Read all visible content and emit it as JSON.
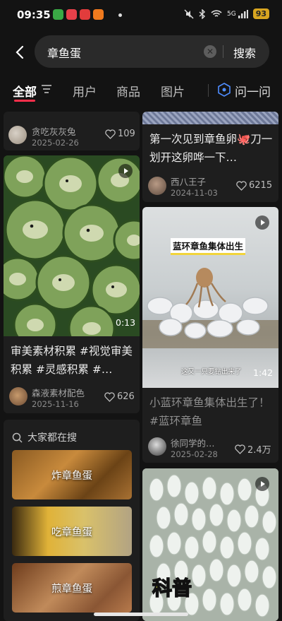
{
  "status": {
    "time": "09:35",
    "battery": "93",
    "network": "5G"
  },
  "search": {
    "query": "章鱼蛋",
    "button": "搜索"
  },
  "tabs": {
    "all": "全部",
    "users": "用户",
    "goods": "商品",
    "images": "图片",
    "ask": "问一问"
  },
  "posts": {
    "p1": {
      "author": "贪吃灰灰兔",
      "date": "2025-02-26",
      "likes": "109"
    },
    "p2": {
      "title": "第一次见到章鱼卵🐙刀一划开这卵哗一下…",
      "author": "西八王子",
      "date": "2024-11-03",
      "likes": "6215"
    },
    "p3": {
      "duration": "0:13",
      "title": "审美素材积累 #视觉审美积累 #灵感积累 #…",
      "author": "森液素材配色",
      "date": "2025-11-16",
      "likes": "626"
    },
    "p4": {
      "overlay": "蓝环章鱼集体出生",
      "subtitle": "这又一只要钻出来了",
      "duration": "1:42",
      "title": "小蓝环章鱼集体出生了！#蓝环章鱼",
      "author": "徐同学的…",
      "date": "2025-02-28",
      "likes": "2.4万"
    },
    "p5": {
      "overlay": "科普"
    }
  },
  "suggest": {
    "header": "大家都在搜",
    "items": [
      "炸章鱼蛋",
      "吃章鱼蛋",
      "煎章鱼蛋"
    ]
  },
  "colors": {
    "accent": "#ff2f4b",
    "bg": "#131313",
    "card": "#1e1e1e"
  }
}
